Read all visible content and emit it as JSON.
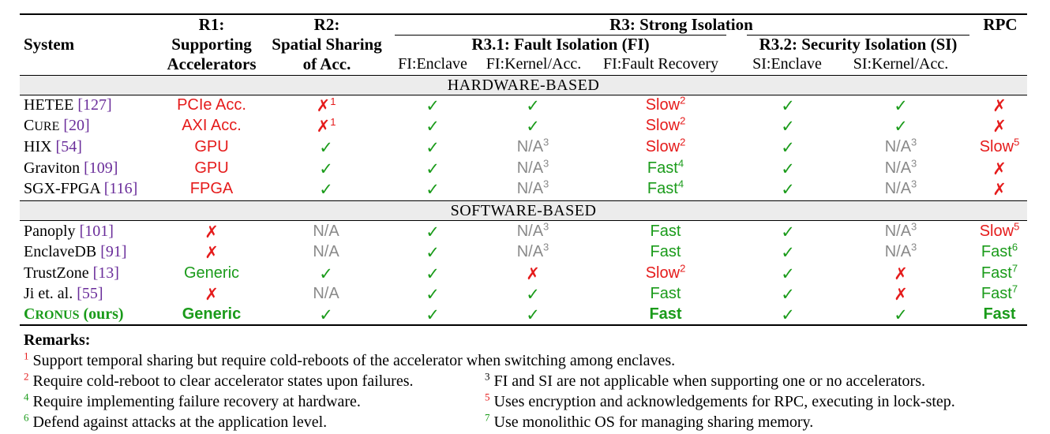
{
  "header": {
    "system": "System",
    "r1": [
      "R1:",
      "Supporting",
      "Accelerators"
    ],
    "r2": [
      "R2:",
      "Spatial Sharing",
      "of Acc."
    ],
    "r3": "R3: Strong Isolation",
    "r31": "R3.1: Fault Isolation (FI)",
    "r32": "R3.2: Security Isolation (SI)",
    "rpc": "RPC",
    "fi_enclave": "FI:Enclave",
    "fi_kernel": "FI:Kernel/Acc.",
    "fi_recovery": "FI:Fault Recovery",
    "si_enclave": "SI:Enclave",
    "si_kernel": "SI:Kernel/Acc."
  },
  "sections": {
    "hardware": "HARDWARE-BASED",
    "software": "SOFTWARE-BASED"
  },
  "colors": {
    "red": "#e51b1b",
    "green": "#1a9b1a",
    "gray": "#8a8a8a",
    "ref": "#6a2d9a"
  },
  "rows": [
    {
      "name": "HETEE",
      "ref": "[127]",
      "r1": {
        "t": "PCIe Acc.",
        "c": "red"
      },
      "r2": {
        "t": "✗",
        "c": "red",
        "s": "1"
      },
      "fie": {
        "t": "✓",
        "c": "green"
      },
      "fik": {
        "t": "✓",
        "c": "green"
      },
      "fir": {
        "t": "Slow",
        "c": "red",
        "s": "2"
      },
      "sie": {
        "t": "✓",
        "c": "green"
      },
      "sik": {
        "t": "✓",
        "c": "green"
      },
      "rpc": {
        "t": "✗",
        "c": "red"
      }
    },
    {
      "name": "CURE",
      "ref": "[20]",
      "sc": true,
      "r1": {
        "t": "AXI Acc.",
        "c": "red"
      },
      "r2": {
        "t": "✗",
        "c": "red",
        "s": "1"
      },
      "fie": {
        "t": "✓",
        "c": "green"
      },
      "fik": {
        "t": "✓",
        "c": "green"
      },
      "fir": {
        "t": "Slow",
        "c": "red",
        "s": "2"
      },
      "sie": {
        "t": "✓",
        "c": "green"
      },
      "sik": {
        "t": "✓",
        "c": "green"
      },
      "rpc": {
        "t": "✗",
        "c": "red"
      }
    },
    {
      "name": "HIX",
      "ref": "[54]",
      "r1": {
        "t": "GPU",
        "c": "red"
      },
      "r2": {
        "t": "✓",
        "c": "green"
      },
      "fie": {
        "t": "✓",
        "c": "green"
      },
      "fik": {
        "t": "N/A",
        "c": "gray",
        "s": "3"
      },
      "fir": {
        "t": "Slow",
        "c": "red",
        "s": "2"
      },
      "sie": {
        "t": "✓",
        "c": "green"
      },
      "sik": {
        "t": "N/A",
        "c": "gray",
        "s": "3"
      },
      "rpc": {
        "t": "Slow",
        "c": "red",
        "s": "5"
      }
    },
    {
      "name": "Graviton",
      "ref": "[109]",
      "r1": {
        "t": "GPU",
        "c": "red"
      },
      "r2": {
        "t": "✓",
        "c": "green"
      },
      "fie": {
        "t": "✓",
        "c": "green"
      },
      "fik": {
        "t": "N/A",
        "c": "gray",
        "s": "3"
      },
      "fir": {
        "t": "Fast",
        "c": "green",
        "s": "4"
      },
      "sie": {
        "t": "✓",
        "c": "green"
      },
      "sik": {
        "t": "N/A",
        "c": "gray",
        "s": "3"
      },
      "rpc": {
        "t": "✗",
        "c": "red"
      }
    },
    {
      "name": "SGX-FPGA",
      "ref": "[116]",
      "r1": {
        "t": "FPGA",
        "c": "red"
      },
      "r2": {
        "t": "✓",
        "c": "green"
      },
      "fie": {
        "t": "✓",
        "c": "green"
      },
      "fik": {
        "t": "N/A",
        "c": "gray",
        "s": "3"
      },
      "fir": {
        "t": "Fast",
        "c": "green",
        "s": "4"
      },
      "sie": {
        "t": "✓",
        "c": "green"
      },
      "sik": {
        "t": "N/A",
        "c": "gray",
        "s": "3"
      },
      "rpc": {
        "t": "✗",
        "c": "red"
      }
    },
    {
      "name": "Panoply",
      "ref": "[101]",
      "r1": {
        "t": "✗",
        "c": "red"
      },
      "r2": {
        "t": "N/A",
        "c": "gray"
      },
      "fie": {
        "t": "✓",
        "c": "green"
      },
      "fik": {
        "t": "N/A",
        "c": "gray",
        "s": "3"
      },
      "fir": {
        "t": "Fast",
        "c": "green"
      },
      "sie": {
        "t": "✓",
        "c": "green"
      },
      "sik": {
        "t": "N/A",
        "c": "gray",
        "s": "3"
      },
      "rpc": {
        "t": "Slow",
        "c": "red",
        "s": "5"
      }
    },
    {
      "name": "EnclaveDB",
      "ref": "[91]",
      "r1": {
        "t": "✗",
        "c": "red"
      },
      "r2": {
        "t": "N/A",
        "c": "gray"
      },
      "fie": {
        "t": "✓",
        "c": "green"
      },
      "fik": {
        "t": "N/A",
        "c": "gray",
        "s": "3"
      },
      "fir": {
        "t": "Fast",
        "c": "green"
      },
      "sie": {
        "t": "✓",
        "c": "green"
      },
      "sik": {
        "t": "N/A",
        "c": "gray",
        "s": "3"
      },
      "rpc": {
        "t": "Fast",
        "c": "green",
        "s": "6"
      }
    },
    {
      "name": "TrustZone",
      "ref": "[13]",
      "r1": {
        "t": "Generic",
        "c": "green"
      },
      "r2": {
        "t": "✓",
        "c": "green"
      },
      "fie": {
        "t": "✓",
        "c": "green"
      },
      "fik": {
        "t": "✗",
        "c": "red"
      },
      "fir": {
        "t": "Slow",
        "c": "red",
        "s": "2"
      },
      "sie": {
        "t": "✓",
        "c": "green"
      },
      "sik": {
        "t": "✗",
        "c": "red"
      },
      "rpc": {
        "t": "Fast",
        "c": "green",
        "s": "7"
      }
    },
    {
      "name": "Ji et. al.",
      "ref": "[55]",
      "r1": {
        "t": "✗",
        "c": "red"
      },
      "r2": {
        "t": "N/A",
        "c": "gray"
      },
      "fie": {
        "t": "✓",
        "c": "green"
      },
      "fik": {
        "t": "✓",
        "c": "green"
      },
      "fir": {
        "t": "Fast",
        "c": "green"
      },
      "sie": {
        "t": "✓",
        "c": "green"
      },
      "sik": {
        "t": "✗",
        "c": "red"
      },
      "rpc": {
        "t": "Fast",
        "c": "green",
        "s": "7"
      }
    },
    {
      "name": "CRONUS (ours)",
      "ref": "",
      "bold": true,
      "r1": {
        "t": "Generic",
        "c": "green",
        "b": true
      },
      "r2": {
        "t": "✓",
        "c": "green"
      },
      "fie": {
        "t": "✓",
        "c": "green"
      },
      "fik": {
        "t": "✓",
        "c": "green"
      },
      "fir": {
        "t": "Fast",
        "c": "green",
        "b": true
      },
      "sie": {
        "t": "✓",
        "c": "green"
      },
      "sik": {
        "t": "✓",
        "c": "green"
      },
      "rpc": {
        "t": "Fast",
        "c": "green",
        "b": true
      }
    }
  ],
  "remarks": {
    "title": "Remarks:",
    "items": [
      {
        "n": "1",
        "text": "Support temporal sharing but require cold-reboots of the accelerator when switching among enclaves."
      },
      {
        "n": "2",
        "text": "Require cold-reboot to clear accelerator states upon failures."
      },
      {
        "n": "3",
        "text": "FI and SI are not applicable when supporting one or no accelerators."
      },
      {
        "n": "4",
        "text": "Require implementing failure recovery at hardware."
      },
      {
        "n": "5",
        "text": "Uses encryption and acknowledgements for RPC, executing in lock-step."
      },
      {
        "n": "6",
        "text": "Defend against attacks at the application level."
      },
      {
        "n": "7",
        "text": "Use monolithic OS for managing sharing memory."
      }
    ]
  }
}
